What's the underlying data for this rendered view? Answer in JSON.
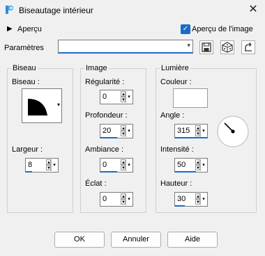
{
  "window": {
    "title": "Biseautage intérieur",
    "close_glyph": "✕"
  },
  "preview": {
    "label": "Aperçu",
    "checkbox_label": "Aperçu de l'image",
    "checked": true
  },
  "params": {
    "label": "Paramètres",
    "value": ""
  },
  "bevel": {
    "group_label": "Biseau",
    "bevel_label": "Biseau :",
    "width_label": "Largeur :",
    "width_value": "8"
  },
  "image": {
    "group_label": "Image",
    "smoothness_label": "Régularité :",
    "smoothness_value": "0",
    "depth_label": "Profondeur :",
    "depth_value": "20",
    "ambience_label": "Ambiance :",
    "ambience_value": "0",
    "shine_label": "Éclat :",
    "shine_value": "0"
  },
  "light": {
    "group_label": "Lumière",
    "color_label": "Couleur :",
    "color_value": "#ffffff",
    "angle_label": "Angle :",
    "angle_value": "315",
    "intensity_label": "Intensité :",
    "intensity_value": "50",
    "elevation_label": "Hauteur :",
    "elevation_value": "30"
  },
  "buttons": {
    "ok": "OK",
    "cancel": "Annuler",
    "help": "Aide"
  },
  "colors": {
    "accent": "#1b6ac9",
    "background": "#f0f0f0"
  }
}
